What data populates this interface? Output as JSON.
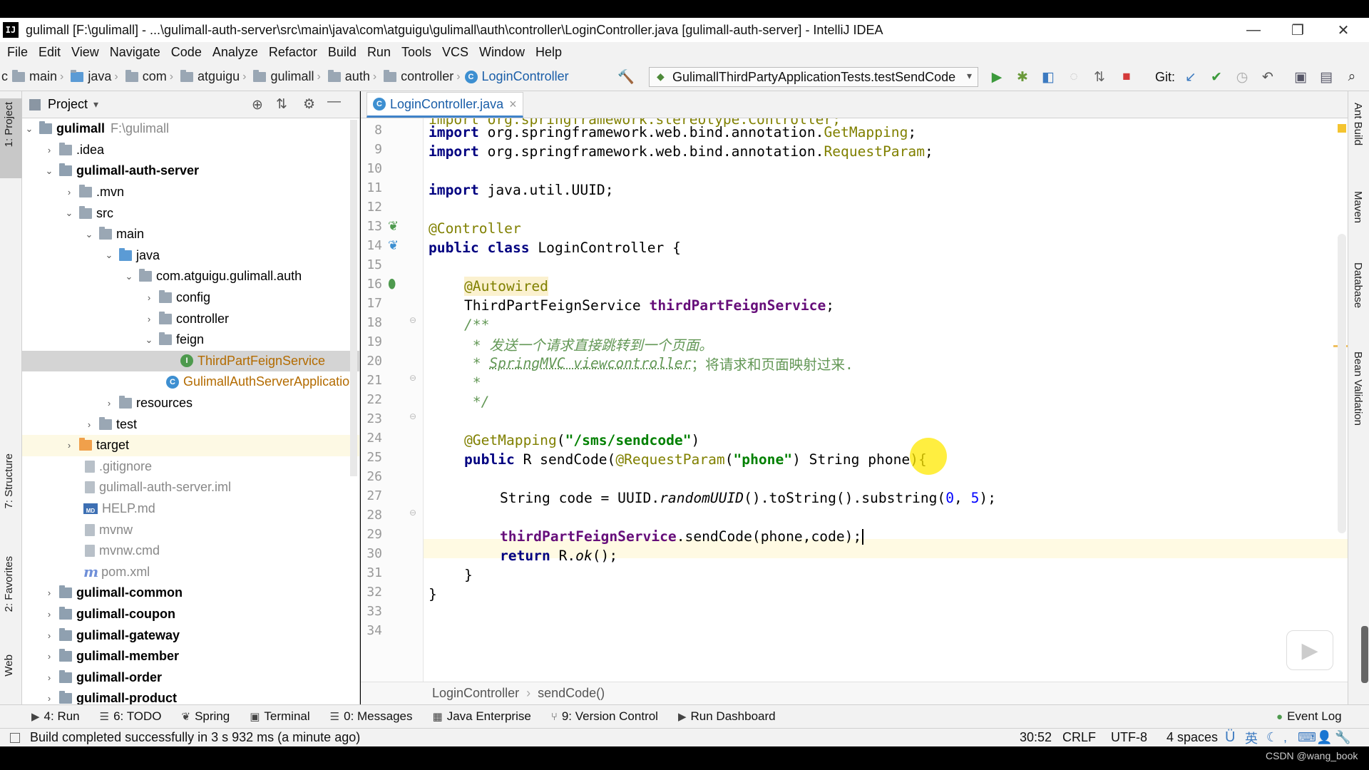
{
  "window": {
    "title": "gulimall [F:\\gulimall] - ...\\gulimall-auth-server\\src\\main\\java\\com\\atguigu\\gulimall\\auth\\controller\\LoginController.java [gulimall-auth-server] - IntelliJ IDEA",
    "logo": "IJ",
    "minimize": "—",
    "restore": "❐",
    "close": "✕"
  },
  "menu": [
    "File",
    "Edit",
    "View",
    "Navigate",
    "Code",
    "Analyze",
    "Refactor",
    "Build",
    "Run",
    "Tools",
    "VCS",
    "Window",
    "Help"
  ],
  "breadcrumbs": [
    "c",
    "main",
    "java",
    "com",
    "atguigu",
    "gulimall",
    "auth",
    "controller",
    "LoginController"
  ],
  "run_config": "GulimallThirdPartyApplicationTests.testSendCode",
  "git_label": "Git:",
  "left_tools": [
    "1: Project",
    "7: Structure",
    "2: Favorites",
    "Web"
  ],
  "right_tools": [
    "Ant Build",
    "Maven",
    "Database",
    "Bean Validation"
  ],
  "project": {
    "header": "Project",
    "tree": [
      {
        "label": "gulimall",
        "extra": "F:\\gulimall"
      },
      {
        "label": ".idea"
      },
      {
        "label": "gulimall-auth-server"
      },
      {
        "label": ".mvn"
      },
      {
        "label": "src"
      },
      {
        "label": "main"
      },
      {
        "label": "java"
      },
      {
        "label": "com.atguigu.gulimall.auth"
      },
      {
        "label": "config"
      },
      {
        "label": "controller"
      },
      {
        "label": "feign"
      },
      {
        "label": "ThirdPartFeignService"
      },
      {
        "label": "GulimallAuthServerApplication"
      },
      {
        "label": "resources"
      },
      {
        "label": "test"
      },
      {
        "label": "target"
      },
      {
        "label": ".gitignore"
      },
      {
        "label": "gulimall-auth-server.iml"
      },
      {
        "label": "HELP.md"
      },
      {
        "label": "mvnw"
      },
      {
        "label": "mvnw.cmd"
      },
      {
        "label": "pom.xml"
      },
      {
        "label": "gulimall-common"
      },
      {
        "label": "gulimall-coupon"
      },
      {
        "label": "gulimall-gateway"
      },
      {
        "label": "gulimall-member"
      },
      {
        "label": "gulimall-order"
      },
      {
        "label": "gulimall-product"
      }
    ]
  },
  "editor": {
    "tab": "LoginController.java",
    "tab_close": "×",
    "line_numbers": [
      "8",
      "9",
      "10",
      "11",
      "12",
      "13",
      "14",
      "15",
      "16",
      "17",
      "18",
      "19",
      "20",
      "21",
      "22",
      "23",
      "24",
      "25",
      "26",
      "27",
      "28",
      "29",
      "30",
      "31",
      "32",
      "33",
      "34"
    ],
    "top_partial": "import org.springframework.stereotype.Controller;",
    "lines": {
      "l8a": "import",
      "l8b": " org.springframework.web.bind.annotation.",
      "l8c": "GetMapping",
      "l8d": ";",
      "l9a": "import",
      "l9b": " org.springframework.web.bind.annotation.",
      "l9c": "RequestParam",
      "l9d": ";",
      "l11a": "import",
      "l11b": " java.util.UUID;",
      "l13": "@Controller",
      "l14a": "public class",
      "l14b": " LoginController {",
      "l16": "@Autowired",
      "l17a": "ThirdPartFeignService ",
      "l17b": "thirdPartFeignService",
      "l17c": ";",
      "l19": "/**",
      "l20": " * 发送一个请求直接跳转到一个页面。",
      "l21a": " * ",
      "l21b": "SpringMVC viewcontroller",
      "l21c": "；将请求和页面映射过来.",
      "l22": " *",
      "l23": " */",
      "l25a": "@GetMapping",
      "l25b": "(",
      "l25c": "\"/sms/sendcode\"",
      "l25d": ")",
      "l26a": "public",
      "l26b": " R sendCode(",
      "l26c": "@RequestParam",
      "l26d": "(",
      "l26e": "\"phone\"",
      "l26f": ") String phone){",
      "l28a": "String code = UUID.",
      "l28b": "randomUUID",
      "l28c": "().toString().substring(",
      "l28d": "0",
      "l28e": ", ",
      "l28f": "5",
      "l28g": ");",
      "l30a": "thirdPartFeignService",
      "l30b": ".sendCode(phone,code);",
      "l31a": "return",
      "l31b": " R.",
      "l31c": "ok",
      "l31d": "();",
      "l32": "}",
      "l33": "}"
    },
    "crumbs": [
      "LoginController",
      "sendCode()"
    ]
  },
  "tool_windows": [
    "4: Run",
    "6: TODO",
    "Spring",
    "Terminal",
    "0: Messages",
    "Java Enterprise",
    "9: Version Control",
    "Run Dashboard",
    "Event Log"
  ],
  "status": {
    "message": "Build completed successfully in 3 s 932 ms (a minute ago)",
    "position": "30:52",
    "line_sep": "CRLF",
    "encoding": "UTF-8",
    "indent": "4 spaces",
    "ime": "英"
  },
  "watermark": "CSDN @wang_book",
  "colors": {
    "accent": "#4083c9",
    "annotation": "#808000",
    "keyword": "#000080",
    "string": "#008000",
    "field": "#660e7a"
  }
}
